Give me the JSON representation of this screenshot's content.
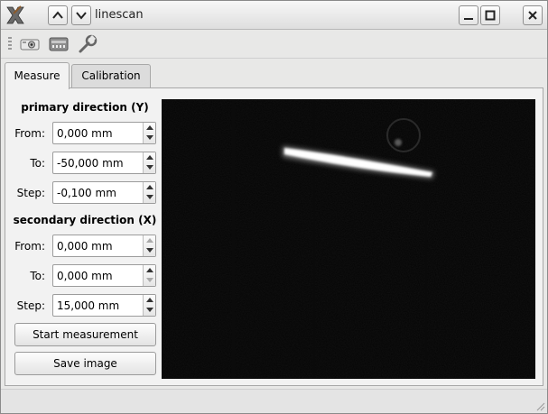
{
  "window": {
    "title": "linescan",
    "icons": [
      "app-icon",
      "arrow-up-icon",
      "arrow-down-icon",
      "minimize-icon",
      "maximize-icon",
      "close-icon"
    ]
  },
  "toolbar": {
    "icons": [
      "camera-icon",
      "device-icon",
      "wrench-icon"
    ]
  },
  "tabs": [
    {
      "label": "Measure",
      "active": true
    },
    {
      "label": "Calibration",
      "active": false
    }
  ],
  "primary": {
    "heading": "primary direction (Y)",
    "from_label": "From:",
    "from_value": "0,000 mm",
    "to_label": "To:",
    "to_value": "-50,000 mm",
    "step_label": "Step:",
    "step_value": "-0,100 mm"
  },
  "secondary": {
    "heading": "secondary direction (X)",
    "from_label": "From:",
    "from_value": "0,000 mm",
    "to_label": "To:",
    "to_value": "0,000 mm",
    "step_label": "Step:",
    "step_value": "15,000 mm"
  },
  "buttons": {
    "start_label": "Start measurement",
    "save_label": "Save image"
  },
  "colors": {
    "image_background": "#030303",
    "laser_line": "#ffffff"
  }
}
